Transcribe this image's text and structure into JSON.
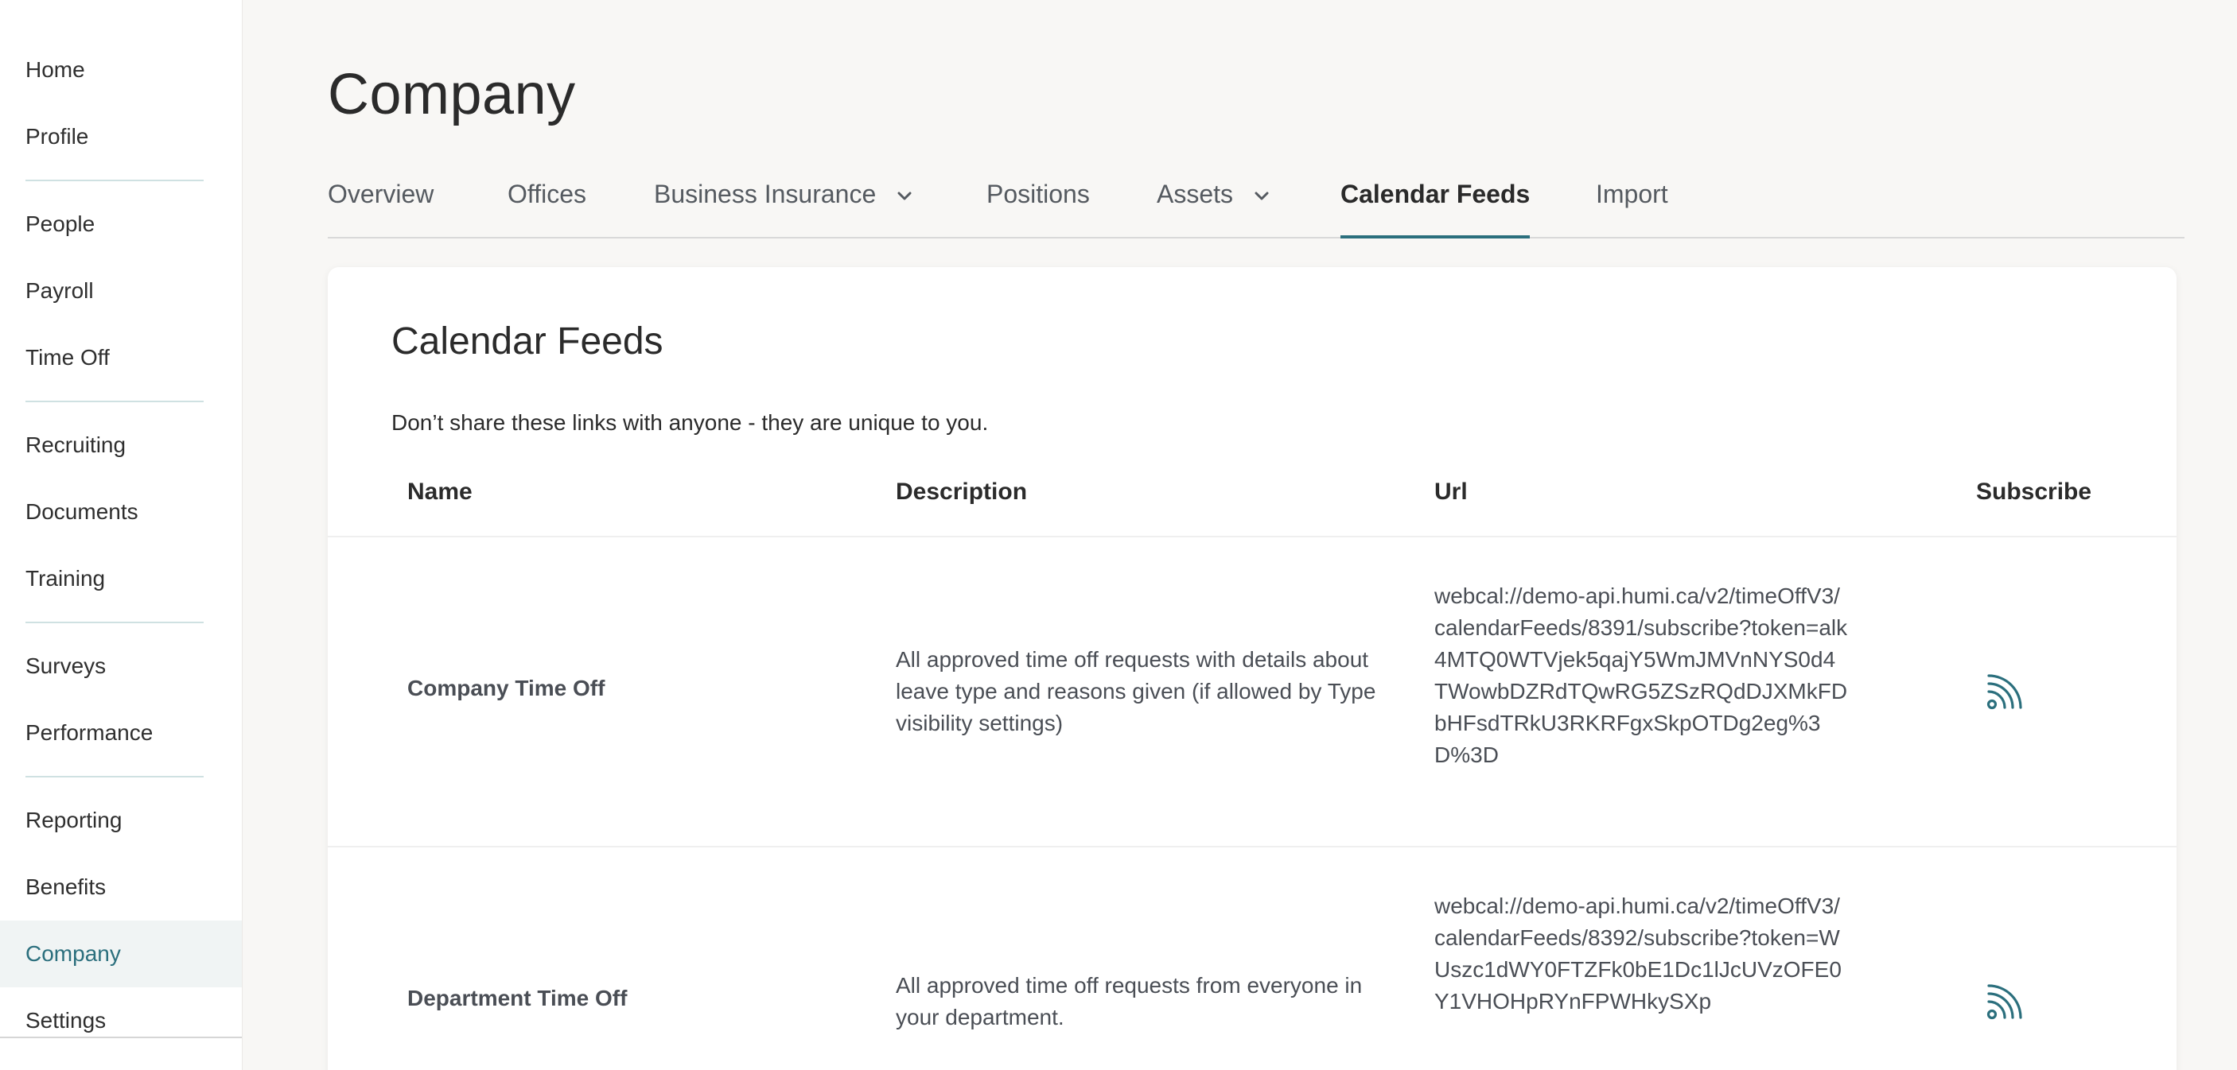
{
  "sidebar": {
    "groups": [
      [
        "Home",
        "Profile"
      ],
      [
        "People",
        "Payroll",
        "Time Off"
      ],
      [
        "Recruiting",
        "Documents",
        "Training"
      ],
      [
        "Surveys",
        "Performance"
      ],
      [
        "Reporting",
        "Benefits",
        "Company",
        "Settings"
      ]
    ],
    "active": "Company"
  },
  "page": {
    "title": "Company"
  },
  "tabs": [
    {
      "label": "Overview",
      "dropdown": false,
      "active": false
    },
    {
      "label": "Offices",
      "dropdown": false,
      "active": false
    },
    {
      "label": "Business Insurance",
      "dropdown": true,
      "active": false
    },
    {
      "label": "Positions",
      "dropdown": false,
      "active": false
    },
    {
      "label": "Assets",
      "dropdown": true,
      "active": false
    },
    {
      "label": "Calendar Feeds",
      "dropdown": false,
      "active": true
    },
    {
      "label": "Import",
      "dropdown": false,
      "active": false
    }
  ],
  "card": {
    "title": "Calendar Feeds",
    "note": "Don’t share these links with anyone - they are unique to you.",
    "columns": {
      "name": "Name",
      "description": "Description",
      "url": "Url",
      "subscribe": "Subscribe"
    },
    "rows": [
      {
        "name": "Company Time Off",
        "description": "All approved time off requests with details about leave type and reasons given (if allowed by Type visibility settings)",
        "url": "webcal://demo-api.humi.ca/v2/timeOffV3/calendarFeeds/8391/subscribe?token=alk4MTQ0WTVjek5qajY5WmJMVnNYS0d4TWowbDZRdTQwRG5ZSzRQdDJXMkFDbHFsdTRkU3RKRFgxSkpOTDg2eg%3D%3D",
        "subscribe_icon": "rss-feed-icon"
      },
      {
        "name": "Department Time Off",
        "description": "All approved time off requests from everyone in your department.",
        "url": "webcal://demo-api.humi.ca/v2/timeOffV3/calendarFeeds/8392/subscribe?token=WUszc1dWY0FTZFk0bE1Dc1lJcUVzOFE0Y1VHOHpRYnFPWHkySXp",
        "subscribe_icon": "rss-feed-icon"
      }
    ]
  },
  "colors": {
    "accent": "#2b6f7d",
    "sidebar_active_bg": "#f0f4f4",
    "divider": "#cfe1e2"
  }
}
